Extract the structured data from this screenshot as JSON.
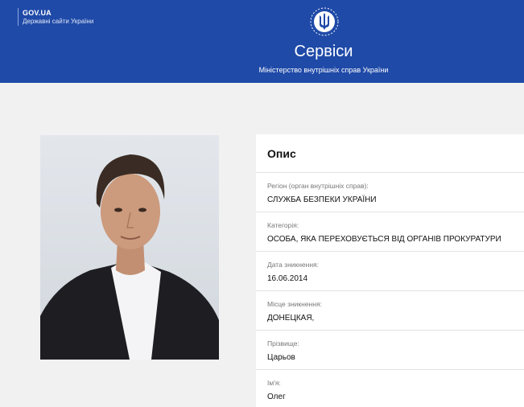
{
  "header": {
    "gov_name": "GOV.UA",
    "gov_sub": "Державні сайти України",
    "title": "Сервіси",
    "subtitle": "Міністерство внутрішніх справ України",
    "emblem_icon": "trident-emblem-icon"
  },
  "card": {
    "title": "Опис",
    "fields": [
      {
        "label": "Регіон (орган внутрішніх справ):",
        "value": "СЛУЖБА БЕЗПЕКИ УКРАЇНИ"
      },
      {
        "label": "Категорія:",
        "value": "ОСОБА, ЯКА ПЕРЕХОВУЄТЬСЯ ВІД ОРГАНІВ ПРОКУРАТУРИ"
      },
      {
        "label": "Дата зникнення:",
        "value": "16.06.2014"
      },
      {
        "label": "Місце зникнення:",
        "value": "ДОНЕЦКАЯ,"
      },
      {
        "label": "Прізвище:",
        "value": "Царьов"
      },
      {
        "label": "Ім'я:",
        "value": "Олег"
      }
    ]
  },
  "colors": {
    "header_bg": "#1f4aa8",
    "page_bg": "#f1f1f1",
    "card_bg": "#ffffff"
  }
}
